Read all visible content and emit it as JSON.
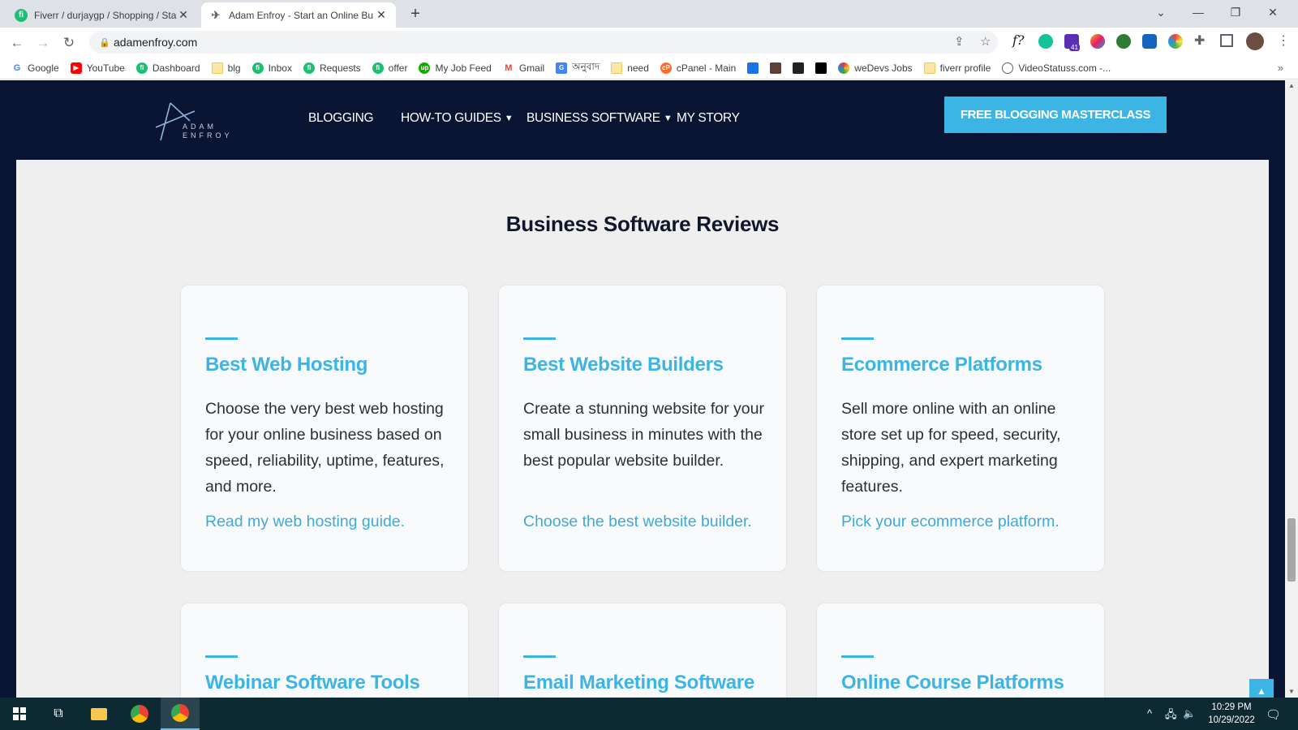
{
  "browser": {
    "tabs": [
      {
        "title": "Fiverr / durjaygp / Shopping / Sta",
        "favicon": "fiverr-icon",
        "active": false
      },
      {
        "title": "Adam Enfroy - Start an Online Bu",
        "favicon": "adam-enfroy-icon",
        "active": true
      }
    ],
    "new_tab": "+",
    "url": "adamenfroy.com",
    "bookmarks": [
      {
        "label": "Google",
        "icon": "google-icon",
        "color": "#4285f4"
      },
      {
        "label": "YouTube",
        "icon": "youtube-icon",
        "color": "#ff0000"
      },
      {
        "label": "Dashboard",
        "icon": "fiverr-icon",
        "color": "#1dbf73"
      },
      {
        "label": "blg",
        "icon": "folder-icon",
        "color": "#fbe7a1"
      },
      {
        "label": "Inbox",
        "icon": "fiverr-icon",
        "color": "#1dbf73"
      },
      {
        "label": "Requests",
        "icon": "fiverr-icon",
        "color": "#1dbf73"
      },
      {
        "label": "offer",
        "icon": "fiverr-icon",
        "color": "#1dbf73"
      },
      {
        "label": "My Job Feed",
        "icon": "upwork-icon",
        "color": "#14a800"
      },
      {
        "label": "Gmail",
        "icon": "gmail-icon",
        "color": "#ea4335"
      },
      {
        "label": "অনুবাদ",
        "icon": "translate-icon",
        "color": "#4285f4"
      },
      {
        "label": "need",
        "icon": "folder-icon",
        "color": "#fbe7a1"
      },
      {
        "label": "cPanel - Main",
        "icon": "cpanel-icon",
        "color": "#ff6c2c"
      },
      {
        "label": "weDevs Jobs",
        "icon": "wedevs-icon",
        "color": "#6b8e23"
      },
      {
        "label": "fiverr profile",
        "icon": "folder-icon",
        "color": "#fbe7a1"
      },
      {
        "label": "VideoStatuss.com -...",
        "icon": "globe-icon",
        "color": "#5f6368"
      }
    ],
    "extension_badge": "41"
  },
  "site": {
    "logo_text_line1": "ADAM",
    "logo_text_line2": "ENFROY",
    "menu": [
      {
        "label": "BLOGGING",
        "dropdown": false
      },
      {
        "label": "HOW-TO GUIDES",
        "dropdown": true
      },
      {
        "label": "BUSINESS SOFTWARE",
        "dropdown": true
      },
      {
        "label": "MY STORY",
        "dropdown": false
      }
    ],
    "cta": "FREE BLOGGING MASTERCLASS",
    "accent_color": "#3cb4e4",
    "nav_bg": "#0a1433"
  },
  "section": {
    "title": "Business Software Reviews",
    "cards": [
      {
        "title": "Best Web Hosting",
        "description": "Choose the very best web hosting for your online business based on speed, reliability, uptime, features, and more.",
        "link": "Read my web hosting guide."
      },
      {
        "title": "Best Website Builders",
        "description": "Create a stunning website for your small business in minutes with the best popular website builder.",
        "link": "Choose the best website builder."
      },
      {
        "title": "Ecommerce Platforms",
        "description": "Sell more online with an online store set up for speed, security, shipping, and expert marketing features.",
        "link": "Pick your ecommerce platform."
      },
      {
        "title": "Webinar Software Tools"
      },
      {
        "title": "Email Marketing Software"
      },
      {
        "title": "Online Course Platforms"
      }
    ]
  },
  "taskbar": {
    "time": "10:29 PM",
    "date": "10/29/2022"
  }
}
